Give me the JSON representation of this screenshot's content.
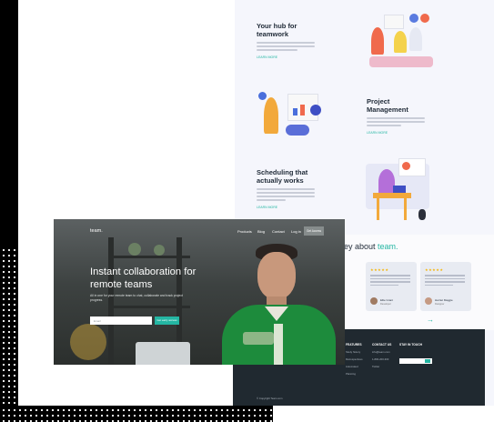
{
  "features": [
    {
      "title_lines": [
        "Your hub for",
        "teamwork"
      ],
      "link": "LEARN MORE"
    },
    {
      "title_lines": [
        "Project",
        "Management"
      ],
      "link": "LEARN MORE"
    },
    {
      "title_lines": [
        "Scheduling that",
        "actually works"
      ],
      "link": "LEARN MORE"
    }
  ],
  "testimonials": {
    "title_prefix": "ey about ",
    "title_brand": "team.",
    "cards": [
      {
        "stars": "★★★★★",
        "name": "",
        "role": ""
      },
      {
        "stars": "★★★★★",
        "name": "Ellie Grant",
        "role": "Developer"
      },
      {
        "stars": "★★★★★",
        "name": "Harriet Maggie",
        "role": "Designer"
      }
    ],
    "arrow": "→"
  },
  "footer": {
    "columns": [
      {
        "head": "FEATURES",
        "links": [
          "Study history",
          "Retrospectives",
          "Automated",
          "Planning"
        ]
      },
      {
        "head": "CONTACT US",
        "links": [
          "info@team.com",
          "1-800-200-300",
          "Twitter"
        ]
      },
      {
        "head": "STAY IN TOUCH",
        "links": []
      }
    ],
    "copyright": "© Copyright Team.com"
  },
  "hero": {
    "logo": "team.",
    "nav": [
      "Products",
      "Blog",
      "Contact",
      "Log in"
    ],
    "nav_button": "Get Access",
    "title": "Instant collaboration for remote teams",
    "subtitle": "All in one for your remote team to chat, collaborate and track project progress.",
    "email_placeholder": "Email",
    "cta": "Get early access"
  },
  "colors": {
    "accent": "#24b6a3",
    "dark": "#202930",
    "background": "#f5f6fc"
  }
}
